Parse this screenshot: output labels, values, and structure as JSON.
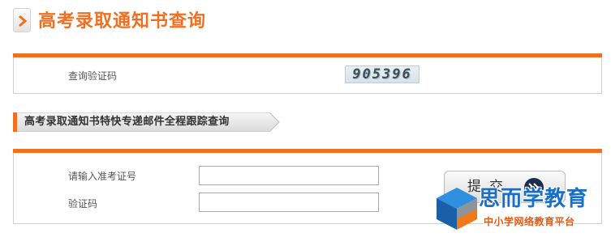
{
  "page": {
    "title": "高考录取通知书查询"
  },
  "captcha_panel": {
    "label": "查询验证码",
    "code": "905396"
  },
  "tracking_section": {
    "title": "高考录取通知书特快专递邮件全程跟踪查询",
    "exam_number_label": "请输入准考证号",
    "exam_number_value": "",
    "verify_code_label": "验证码",
    "verify_code_value": "",
    "submit_label": "提交"
  },
  "watermark": {
    "brand": "思而学教育",
    "tagline": "中小学网络教育平台"
  },
  "icons": {
    "title_marker": "chevron-right-icon",
    "submit_arrow": "double-chevron-right-icon",
    "logo": "cube-logo-icon"
  },
  "colors": {
    "accent": "#f26f21",
    "border": "#cfcfcf",
    "submit_arrow_bg": "#1c2c4c",
    "brand_blue": "#1a6fc4",
    "brand_orange": "#e05a16"
  }
}
